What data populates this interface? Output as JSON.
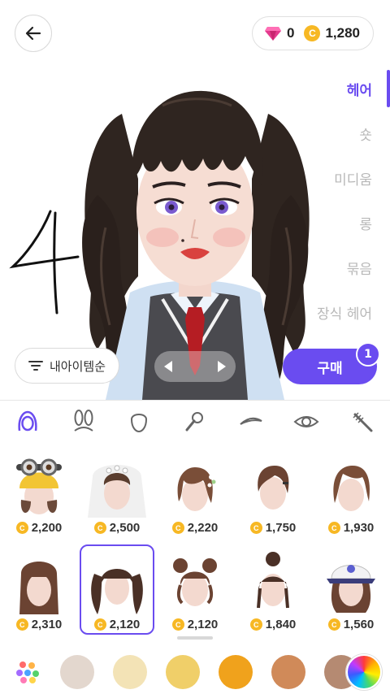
{
  "currency": {
    "gems": "0",
    "coins": "1,280"
  },
  "categories": [
    {
      "label": "헤어",
      "active": true
    },
    {
      "label": "숏",
      "active": false
    },
    {
      "label": "미디움",
      "active": false
    },
    {
      "label": "롱",
      "active": false
    },
    {
      "label": "묶음",
      "active": false
    },
    {
      "label": "장식 헤어",
      "active": false
    }
  ],
  "sort_label": "내아이템순",
  "buy": {
    "label": "구매",
    "badge": "1"
  },
  "tools": [
    "hair-icon",
    "bunny-ears-icon",
    "face-shape-icon",
    "mic-icon",
    "eyebrow-icon",
    "eye-icon",
    "mascara-icon"
  ],
  "items": [
    {
      "price": "2,200",
      "style": "minion-beanie"
    },
    {
      "price": "2,500",
      "style": "bridal-veil"
    },
    {
      "price": "2,220",
      "style": "flower-bob"
    },
    {
      "price": "1,750",
      "style": "short-pin"
    },
    {
      "price": "1,930",
      "style": "side-bob"
    },
    {
      "price": "2,310",
      "style": "long-straight"
    },
    {
      "price": "2,120",
      "style": "twin-tails",
      "selected": true
    },
    {
      "price": "2,120",
      "style": "double-buns"
    },
    {
      "price": "1,840",
      "style": "top-bun"
    },
    {
      "price": "1,560",
      "style": "baseball-cap"
    }
  ],
  "swatches": [
    "#e3d7ce",
    "#f3e3b6",
    "#f0cf69",
    "#f0a21c",
    "#d08a59",
    "#b58a72"
  ],
  "colors": {
    "accent": "#6a4cf0",
    "hair": "#2f2520",
    "coin": "#f7b824"
  }
}
